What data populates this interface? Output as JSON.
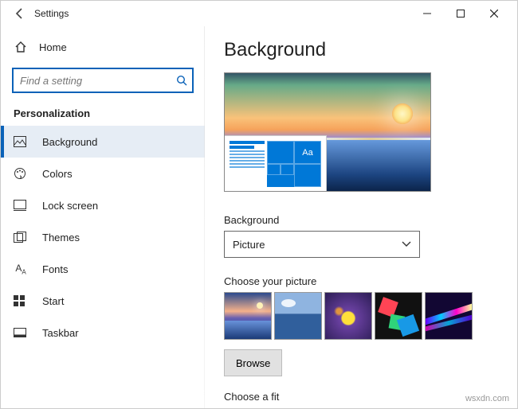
{
  "titlebar": {
    "appName": "Settings"
  },
  "sidebar": {
    "homeLabel": "Home",
    "searchPlaceholder": "Find a setting",
    "groupLabel": "Personalization",
    "items": [
      {
        "label": "Background"
      },
      {
        "label": "Colors"
      },
      {
        "label": "Lock screen"
      },
      {
        "label": "Themes"
      },
      {
        "label": "Fonts"
      },
      {
        "label": "Start"
      },
      {
        "label": "Taskbar"
      }
    ]
  },
  "content": {
    "pageTitle": "Background",
    "previewSampleText": "Aa",
    "bgTypeLabel": "Background",
    "bgTypeValue": "Picture",
    "choosePictureLabel": "Choose your picture",
    "browseLabel": "Browse",
    "chooseFitLabel": "Choose a fit"
  },
  "footer": {
    "watermark": "wsxdn.com"
  }
}
